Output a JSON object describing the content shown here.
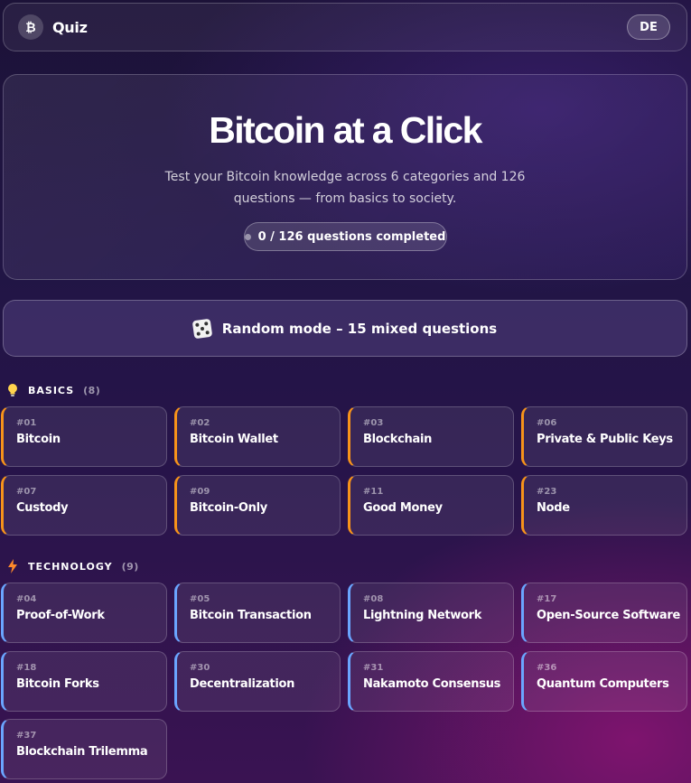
{
  "header": {
    "logo": "₿",
    "title": "Quiz",
    "lang": "DE"
  },
  "hero": {
    "title": "Bitcoin at a Click",
    "subtitle": "Test your Bitcoin knowledge across 6 categories and 126 questions — from basics to society.",
    "progress": "0 / 126 questions completed"
  },
  "random": {
    "label": "Random mode – 15 mixed questions"
  },
  "categories": [
    {
      "name": "BASICS",
      "count": "(8)",
      "icon": "lightbulb-icon",
      "accent": "#f7931a",
      "cards": [
        {
          "num": "#01",
          "title": "Bitcoin"
        },
        {
          "num": "#02",
          "title": "Bitcoin Wallet"
        },
        {
          "num": "#03",
          "title": "Blockchain"
        },
        {
          "num": "#06",
          "title": "Private & Public Keys"
        },
        {
          "num": "#07",
          "title": "Custody"
        },
        {
          "num": "#09",
          "title": "Bitcoin-Only"
        },
        {
          "num": "#11",
          "title": "Good Money"
        },
        {
          "num": "#23",
          "title": "Node"
        }
      ]
    },
    {
      "name": "TECHNOLOGY",
      "count": "(9)",
      "icon": "lightning-icon",
      "accent": "#6aa5ff",
      "cards": [
        {
          "num": "#04",
          "title": "Proof-of-Work"
        },
        {
          "num": "#05",
          "title": "Bitcoin Transaction"
        },
        {
          "num": "#08",
          "title": "Lightning Network"
        },
        {
          "num": "#17",
          "title": "Open-Source Software"
        },
        {
          "num": "#18",
          "title": "Bitcoin Forks"
        },
        {
          "num": "#30",
          "title": "Decentralization"
        },
        {
          "num": "#31",
          "title": "Nakamoto Consensus"
        },
        {
          "num": "#36",
          "title": "Quantum Computers"
        },
        {
          "num": "#37",
          "title": "Blockchain Trilemma"
        }
      ]
    }
  ]
}
